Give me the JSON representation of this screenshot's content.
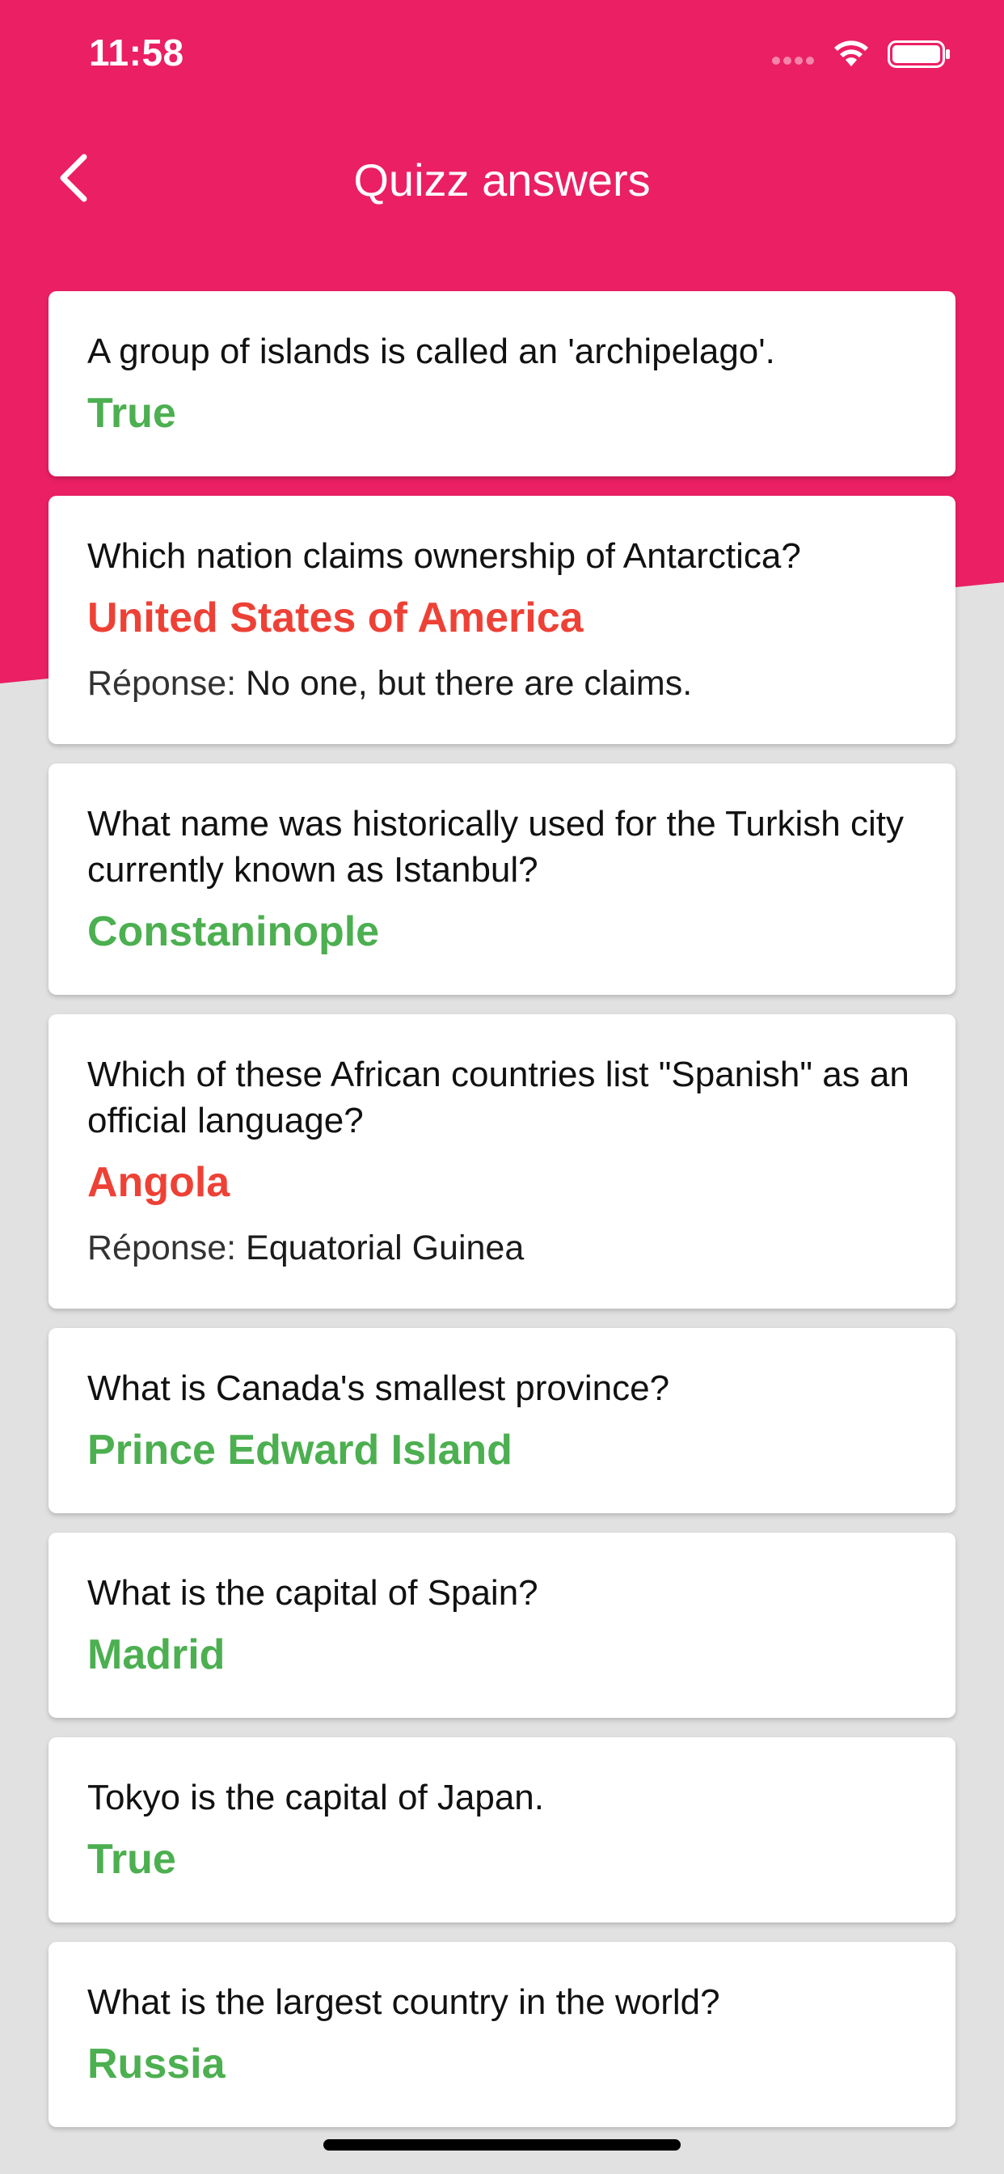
{
  "status_bar": {
    "time": "11:58"
  },
  "nav": {
    "title": "Quizz answers"
  },
  "colors": {
    "primary": "#eb1f64",
    "correct": "#4caf50",
    "wrong": "#ee4136",
    "background": "#e1e1e1"
  },
  "answers": [
    {
      "question": "A group of islands is called an 'archipelago'.",
      "given": "True",
      "status": "correct"
    },
    {
      "question": "Which nation claims ownership of Antarctica?",
      "given": "United States of America",
      "status": "wrong",
      "correction_label": "Réponse:",
      "correction": "No one, but there are claims."
    },
    {
      "question": "What name was historically used for the Turkish city currently known as Istanbul?",
      "given": "Constaninople",
      "status": "correct"
    },
    {
      "question": "Which of these African countries list \"Spanish\" as an official language?",
      "given": "Angola",
      "status": "wrong",
      "correction_label": "Réponse:",
      "correction": "Equatorial Guinea"
    },
    {
      "question": "What is Canada's smallest province?",
      "given": "Prince Edward Island",
      "status": "correct"
    },
    {
      "question": "What is the capital of Spain?",
      "given": "Madrid",
      "status": "correct"
    },
    {
      "question": "Tokyo is the capital of Japan.",
      "given": "True",
      "status": "correct"
    },
    {
      "question": "What is the largest country in the world?",
      "given": "Russia",
      "status": "correct"
    }
  ]
}
